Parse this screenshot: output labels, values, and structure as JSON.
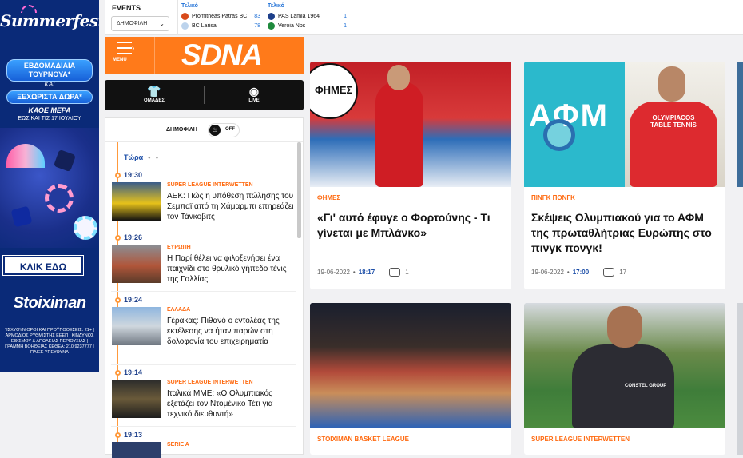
{
  "ad": {
    "title": "Summerfest",
    "badge1": "ΕΒΔΟΜΑΔΙΑΙΑ ΤΟΥΡΝΟΥΑ*",
    "kai": "ΚΑΙ",
    "badge2": "ΞΕΧΩΡΙΣΤΑ ΔΩΡΑ*",
    "every_day": "ΚΑΘΕ ΜΕΡΑ",
    "until": "ΕΩΣ ΚΑΙ ΤΙΣ 17 ΙΟΥΛΙΟΥ",
    "cta": "ΚΛΙΚ ΕΔΩ",
    "brand": "Stoiximan",
    "fine_print": "*ΙΣΧΥΟΥΝ ΟΡΟΙ ΚΑΙ ΠΡΟΫΠΟΘΕΣΕΙΣ. 21+ | ΑΡΜΟΔΙΟΣ ΡΥΘΜΙΣΤΗΣ ΕΕΕΠ | ΚΙΝΔΥΝΟΣ ΕΘΙΣΜΟΥ & ΑΠΩΛΕΙΑΣ ΠΕΡΙΟΥΣΙΑΣ | ΓΡΑΜΜΗ ΒΟΗΘΕΙΑΣ ΚΕΘΕΑ: 210 9237777 | ΠΑΙΞΕ ΥΠΕΥΘΥΝΑ"
  },
  "events": {
    "label": "EVENTS",
    "filter_value": "ΔΗΜΟΦΙΛΗ",
    "matches": [
      {
        "status": "Τελικό",
        "home": "Promitheas Patras BC",
        "home_score": "83",
        "away": "BC Larisa",
        "away_score": "78"
      },
      {
        "status": "Τελικό",
        "home": "PAS Lamia 1964",
        "home_score": "1",
        "away": "Veroia Nps",
        "away_score": "1"
      }
    ]
  },
  "logo": {
    "menu": "MENU",
    "word": "SDNA"
  },
  "nav": {
    "teams": "ΟΜΑΔΕΣ",
    "live": "LIVE"
  },
  "feed": {
    "filter_label": "ΔΗΜΟΦΙΛΗ",
    "toggle": "OFF",
    "now": "Τώρα",
    "items": [
      {
        "time": "19:30",
        "category": "SUPER LEAGUE INTERWETTEN",
        "headline": "ΑΕΚ: Πώς η υπόθεση πώλησης του Σεμπαϊ από τη Χάμαρμπι επηρεάζει τον Τάνκοβιτς"
      },
      {
        "time": "19:26",
        "category": "ΕΥΡΩΠΗ",
        "headline": "Η Παρί θέλει να φιλοξενήσει ένα παιχνίδι στο θρυλικό γήπεδο τένις της Γαλλίας"
      },
      {
        "time": "19:24",
        "category": "ΕΛΛΑΔΑ",
        "headline": "Γέρακας: Πιθανό ο εντολέας της εκτέλεσης να ήταν παρών στη δολοφονία του επιχειρηματία"
      },
      {
        "time": "19:14",
        "category": "SUPER LEAGUE INTERWETTEN",
        "headline": "Ιταλικά ΜΜΕ: «Ο Ολυμπιακός εξετάζει τον Ντομένικο Τέτι για τεχνικό διευθυντή»"
      },
      {
        "time": "19:13",
        "category": "SERIE A",
        "headline": ""
      }
    ]
  },
  "cards": [
    {
      "category": "ΦΗΜΕΣ",
      "headline": "«Γι' αυτό έφυγε ο Φορτούνης - Τι γίνεται με Μπλάνκο»",
      "date": "19-06-2022",
      "time": "18:17",
      "comments": "1",
      "image_text": "ΦΗΜΕΣ"
    },
    {
      "category": "ΠΙΝΓΚ ΠΟΝΓΚ",
      "headline": "Σκέψεις Ολυμπιακού για το ΑΦΜ της πρωταθλήτριας Ευρώπης στο πινγκ πονγκ!",
      "date": "19-06-2022",
      "time": "17:00",
      "comments": "17",
      "image_text": "ΑΦΜ",
      "shirt_text": "OLYMPIACOS TABLE TENNIS"
    },
    {
      "category": "STOIXIMAN BASKET LEAGUE",
      "headline": "",
      "date": "",
      "time": "",
      "comments": ""
    },
    {
      "category": "SUPER LEAGUE INTERWETTEN",
      "headline": "",
      "date": "",
      "time": "",
      "comments": "",
      "shirt_text": "CONSTEL GROUP"
    }
  ],
  "colors": {
    "brand": "#ff7a1a",
    "accent": "#1d4fa8",
    "category": "#ff6b12"
  }
}
